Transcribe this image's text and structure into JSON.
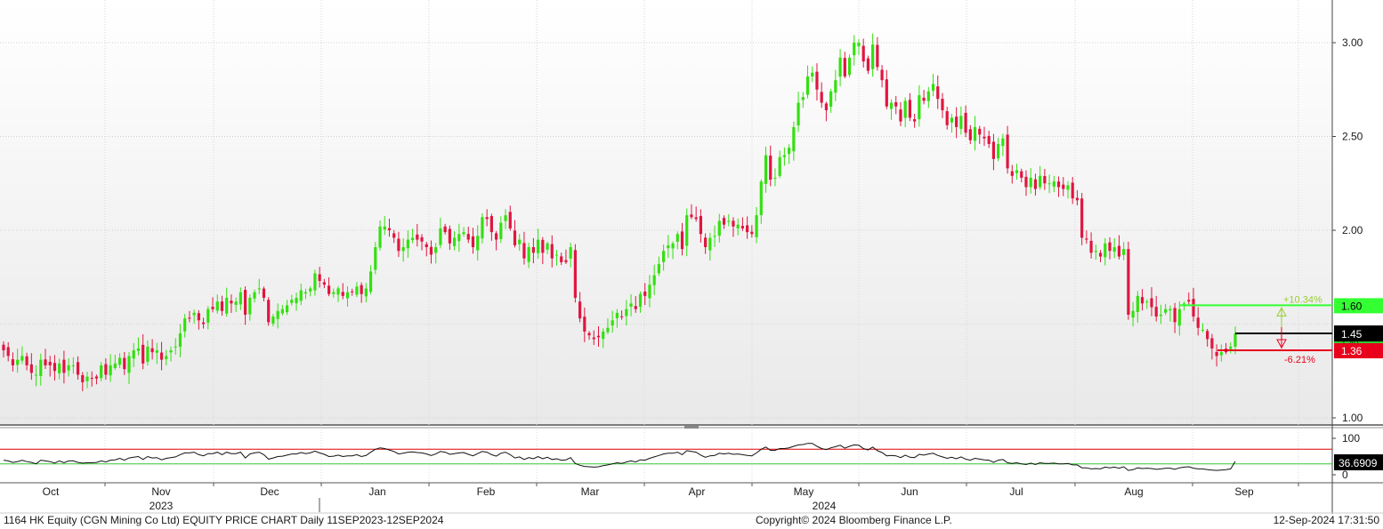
{
  "footer": {
    "left": "1164 HK Equity (CGN Mining Co Ltd) EQUITY PRICE CHART  Daily 11SEP2023-12SEP2024",
    "center": "Copyright© 2024 Bloomberg Finance L.P.",
    "right": "12-Sep-2024 17:31:50"
  },
  "colors": {
    "up": "#33e010",
    "down": "#e01540",
    "last_price_tag": "#000000",
    "upper_target": "#33ff33",
    "lower_target": "#e8001c",
    "upper_pct_text": "#9acd32",
    "lower_pct_text": "#e8001c",
    "rsi_line": "#111111",
    "rsi_high_line": "#e00000",
    "rsi_low_line": "#33cc33"
  },
  "chart_data": [
    {
      "type": "candlestick",
      "title": "",
      "xlabel": "",
      "ylabel": "",
      "ylim": [
        0.97,
        3.2
      ],
      "yticks": [
        "1.00",
        "2.00",
        "2.50",
        "3.00"
      ],
      "grid": true,
      "x_axis": {
        "months": [
          "Oct",
          "Nov",
          "Dec",
          "Jan",
          "Feb",
          "Mar",
          "Apr",
          "May",
          "Jun",
          "Jul",
          "Aug",
          "Sep"
        ],
        "year_labels": [
          "2023",
          "2024"
        ]
      },
      "closes": [
        1.36,
        1.33,
        1.28,
        1.31,
        1.33,
        1.28,
        1.24,
        1.23,
        1.31,
        1.28,
        1.28,
        1.25,
        1.29,
        1.24,
        1.28,
        1.28,
        1.23,
        1.19,
        1.22,
        1.21,
        1.21,
        1.28,
        1.23,
        1.28,
        1.29,
        1.32,
        1.26,
        1.33,
        1.36,
        1.37,
        1.29,
        1.38,
        1.35,
        1.36,
        1.31,
        1.33,
        1.36,
        1.38,
        1.45,
        1.53,
        1.53,
        1.56,
        1.52,
        1.5,
        1.58,
        1.58,
        1.62,
        1.57,
        1.64,
        1.61,
        1.62,
        1.67,
        1.55,
        1.64,
        1.67,
        1.69,
        1.64,
        1.51,
        1.54,
        1.57,
        1.58,
        1.6,
        1.63,
        1.64,
        1.68,
        1.67,
        1.69,
        1.77,
        1.73,
        1.71,
        1.66,
        1.67,
        1.69,
        1.65,
        1.67,
        1.67,
        1.7,
        1.66,
        1.69,
        1.78,
        1.91,
        2.02,
        2.02,
        2.0,
        1.96,
        1.89,
        1.91,
        1.95,
        1.96,
        1.95,
        1.94,
        1.91,
        1.87,
        1.91,
        2.01,
        1.99,
        1.93,
        1.96,
        1.98,
        1.99,
        1.95,
        1.91,
        1.97,
        2.07,
        2.06,
        1.99,
        1.95,
        2.04,
        2.08,
        2.01,
        1.92,
        1.95,
        1.85,
        1.91,
        1.88,
        1.95,
        1.88,
        1.93,
        1.85,
        1.87,
        1.83,
        1.83,
        1.91,
        1.64,
        1.53,
        1.46,
        1.44,
        1.42,
        1.43,
        1.46,
        1.48,
        1.52,
        1.56,
        1.54,
        1.58,
        1.61,
        1.58,
        1.66,
        1.65,
        1.71,
        1.76,
        1.82,
        1.89,
        1.92,
        1.93,
        1.98,
        1.9,
        2.08,
        2.07,
        2.06,
        1.98,
        1.91,
        1.96,
        1.97,
        2.05,
        2.03,
        2.05,
        2.02,
        2.03,
        2.01,
        1.99,
        1.98,
        2.08,
        2.26,
        2.4,
        2.27,
        2.28,
        2.39,
        2.4,
        2.44,
        2.55,
        2.68,
        2.71,
        2.82,
        2.84,
        2.75,
        2.68,
        2.64,
        2.74,
        2.8,
        2.92,
        2.82,
        2.92,
        3.0,
        3.0,
        2.9,
        2.85,
        2.99,
        2.87,
        2.8,
        2.66,
        2.68,
        2.66,
        2.58,
        2.69,
        2.6,
        2.58,
        2.72,
        2.69,
        2.74,
        2.78,
        2.7,
        2.64,
        2.56,
        2.6,
        2.55,
        2.61,
        2.52,
        2.48,
        2.55,
        2.51,
        2.49,
        2.46,
        2.38,
        2.46,
        2.49,
        2.33,
        2.29,
        2.32,
        2.28,
        2.23,
        2.28,
        2.22,
        2.29,
        2.25,
        2.25,
        2.26,
        2.23,
        2.22,
        2.24,
        2.17,
        2.16,
        1.96,
        1.95,
        1.88,
        1.89,
        1.86,
        1.93,
        1.89,
        1.91,
        1.86,
        1.9,
        1.55,
        1.57,
        1.65,
        1.61,
        1.62,
        1.59,
        1.54,
        1.55,
        1.58,
        1.58,
        1.51,
        1.58,
        1.61,
        1.62,
        1.54,
        1.48,
        1.47,
        1.42,
        1.37,
        1.33,
        1.35,
        1.35,
        1.38,
        1.45
      ],
      "last_price": "1.45",
      "reference_price": "1.40",
      "upper_target": {
        "value": "1.60",
        "pct": "+10.34%"
      },
      "lower_target": {
        "value": "1.36",
        "pct": "-6.21%"
      }
    },
    {
      "type": "line",
      "title": "",
      "ylim": [
        0,
        100
      ],
      "yticks": [
        "0",
        "100"
      ],
      "overbought": 70,
      "oversold": 30,
      "values": [
        40,
        38,
        34,
        36,
        40,
        36,
        34,
        30,
        40,
        38,
        36,
        32,
        38,
        33,
        38,
        38,
        34,
        32,
        33,
        33,
        34,
        38,
        35,
        40,
        41,
        45,
        40,
        46,
        48,
        50,
        42,
        50,
        46,
        47,
        41,
        45,
        47,
        49,
        55,
        60,
        60,
        62,
        55,
        52,
        58,
        58,
        62,
        55,
        62,
        58,
        58,
        62,
        46,
        57,
        60,
        62,
        55,
        43,
        46,
        50,
        51,
        54,
        57,
        57,
        61,
        58,
        60,
        65,
        60,
        56,
        50,
        51,
        54,
        50,
        52,
        52,
        55,
        50,
        53,
        62,
        70,
        74,
        72,
        68,
        64,
        57,
        59,
        62,
        63,
        61,
        60,
        57,
        53,
        57,
        64,
        62,
        56,
        58,
        60,
        61,
        56,
        52,
        58,
        64,
        62,
        55,
        51,
        59,
        62,
        55,
        46,
        49,
        42,
        47,
        44,
        50,
        44,
        48,
        42,
        44,
        40,
        41,
        47,
        31,
        26,
        23,
        22,
        21,
        22,
        25,
        27,
        30,
        33,
        31,
        35,
        38,
        35,
        41,
        40,
        45,
        49,
        53,
        57,
        59,
        59,
        62,
        55,
        66,
        64,
        62,
        54,
        48,
        52,
        53,
        59,
        57,
        59,
        56,
        57,
        55,
        53,
        52,
        60,
        70,
        76,
        67,
        67,
        72,
        72,
        74,
        78,
        82,
        83,
        86,
        86,
        78,
        72,
        69,
        74,
        77,
        81,
        73,
        78,
        82,
        81,
        72,
        68,
        76,
        66,
        61,
        52,
        53,
        52,
        47,
        54,
        48,
        47,
        56,
        54,
        57,
        59,
        53,
        49,
        45,
        48,
        44,
        49,
        43,
        40,
        45,
        43,
        41,
        40,
        34,
        40,
        42,
        33,
        31,
        33,
        30,
        28,
        32,
        28,
        33,
        31,
        31,
        32,
        30,
        30,
        31,
        27,
        27,
        19,
        19,
        16,
        17,
        16,
        21,
        19,
        21,
        18,
        22,
        12,
        14,
        19,
        17,
        18,
        17,
        15,
        16,
        18,
        18,
        15,
        19,
        21,
        22,
        18,
        16,
        16,
        14,
        13,
        12,
        13,
        14,
        16,
        36.69
      ],
      "last_value": "36.6909"
    }
  ]
}
